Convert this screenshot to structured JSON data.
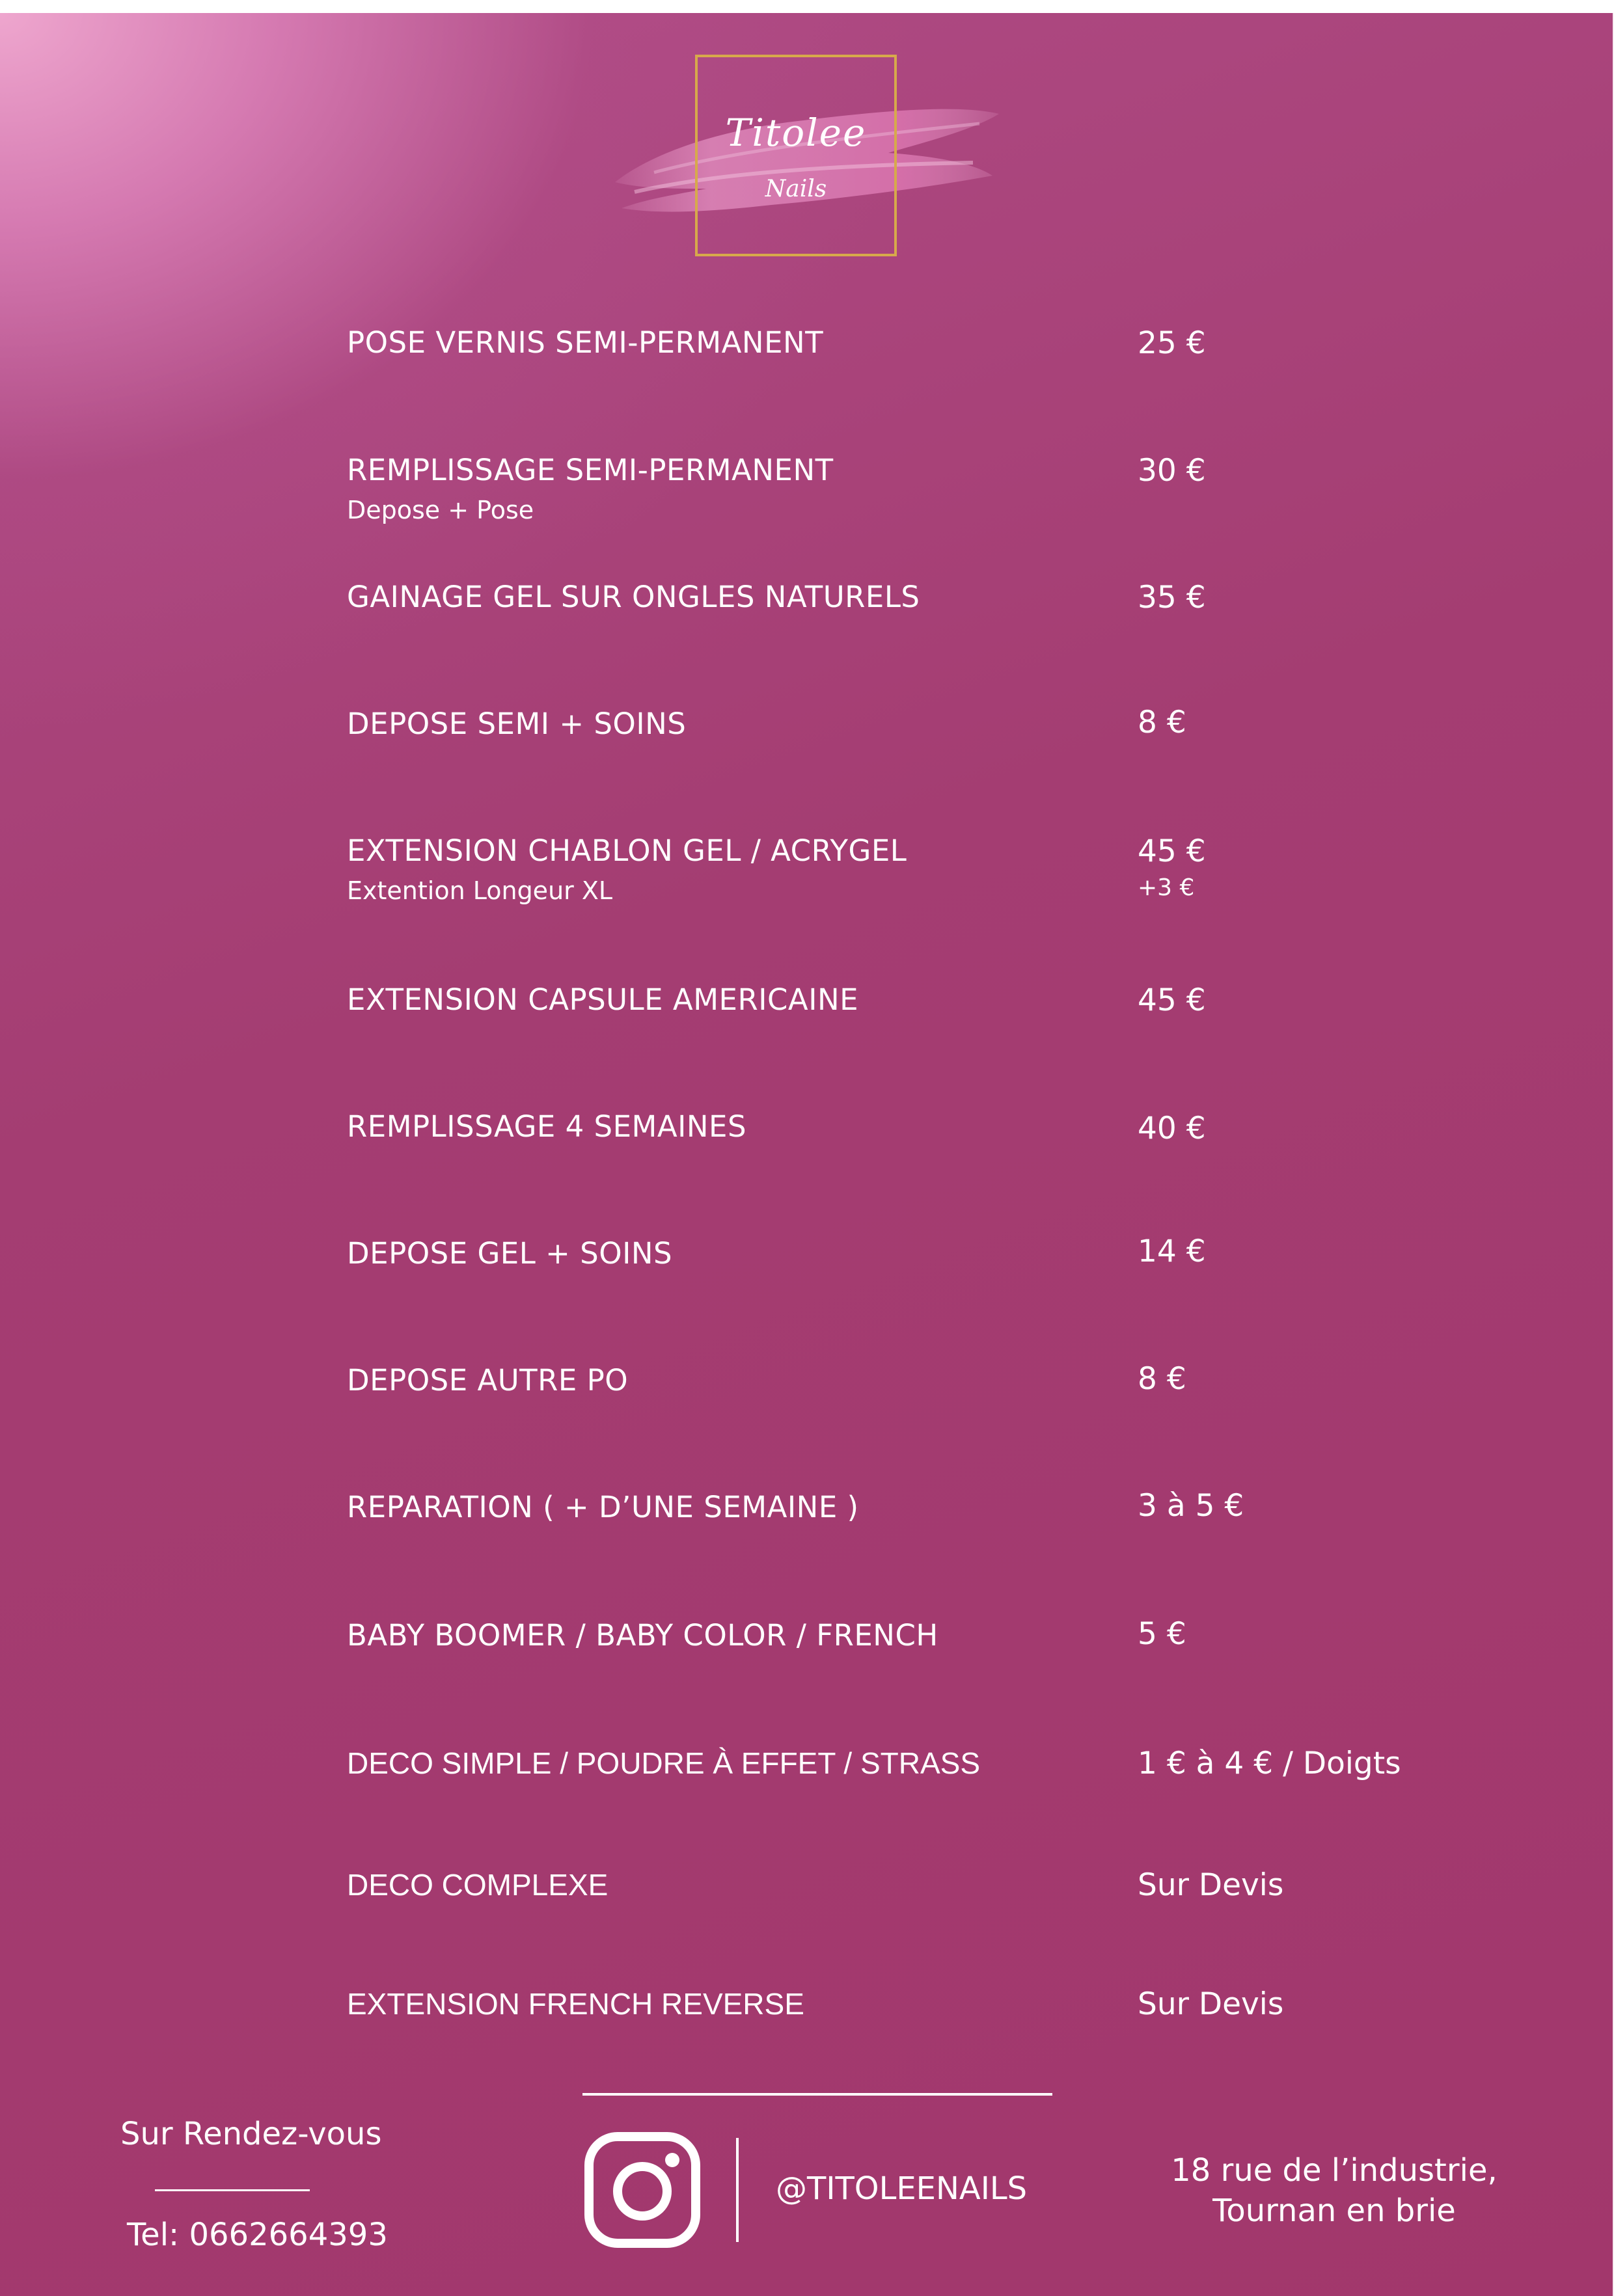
{
  "logo": {
    "title": "Titolee",
    "subtitle": "Nails"
  },
  "services": [
    {
      "name": "POSE VERNIS SEMI-PERMANENT",
      "price": "25 €"
    },
    {
      "name": "REMPLISSAGE SEMI-PERMANENT",
      "note": "Depose + Pose",
      "price": "30 €"
    },
    {
      "name": "GAINAGE GEL SUR ONGLES NATURELS",
      "price": "35 €"
    },
    {
      "name": "DEPOSE SEMI + SOINS",
      "price": "8 €"
    },
    {
      "name": "EXTENSION CHABLON GEL / ACRYGEL",
      "note": "Extention Longeur XL",
      "price": "45 €",
      "extra": "+3 €"
    },
    {
      "name": "EXTENSION CAPSULE AMERICAINE",
      "price": "45 €"
    },
    {
      "name": "REMPLISSAGE 4 SEMAINES",
      "price": "40 €"
    },
    {
      "name": "DEPOSE GEL + SOINS",
      "price": "14 €"
    },
    {
      "name": "DEPOSE AUTRE PO",
      "price": "8 €"
    },
    {
      "name": "REPARATION ( + D’UNE SEMAINE )",
      "price": "3 à 5 €"
    },
    {
      "name": "BABY BOOMER / BABY COLOR / FRENCH",
      "price": "5 €"
    },
    {
      "name": "DECO SIMPLE / POUDRE À EFFET / STRASS",
      "price": "1 € à 4 € / Doigts"
    },
    {
      "name": "DECO COMPLEXE",
      "price": "Sur Devis"
    },
    {
      "name": "EXTENSION FRENCH REVERSE",
      "price": "Sur Devis"
    }
  ],
  "footer": {
    "appointment": "Sur Rendez-vous",
    "phone": "Tel: 0662664393",
    "instagram_icon": "instagram-icon",
    "instagram_handle": "@TITOLEENAILS",
    "address_line1": "18 rue de l’industrie,",
    "address_line2": "Tournan en brie"
  },
  "colors": {
    "background": "#a43d72",
    "highlight": "#eea6ce",
    "logo_frame": "#d7a94b",
    "text": "#ffffff"
  }
}
